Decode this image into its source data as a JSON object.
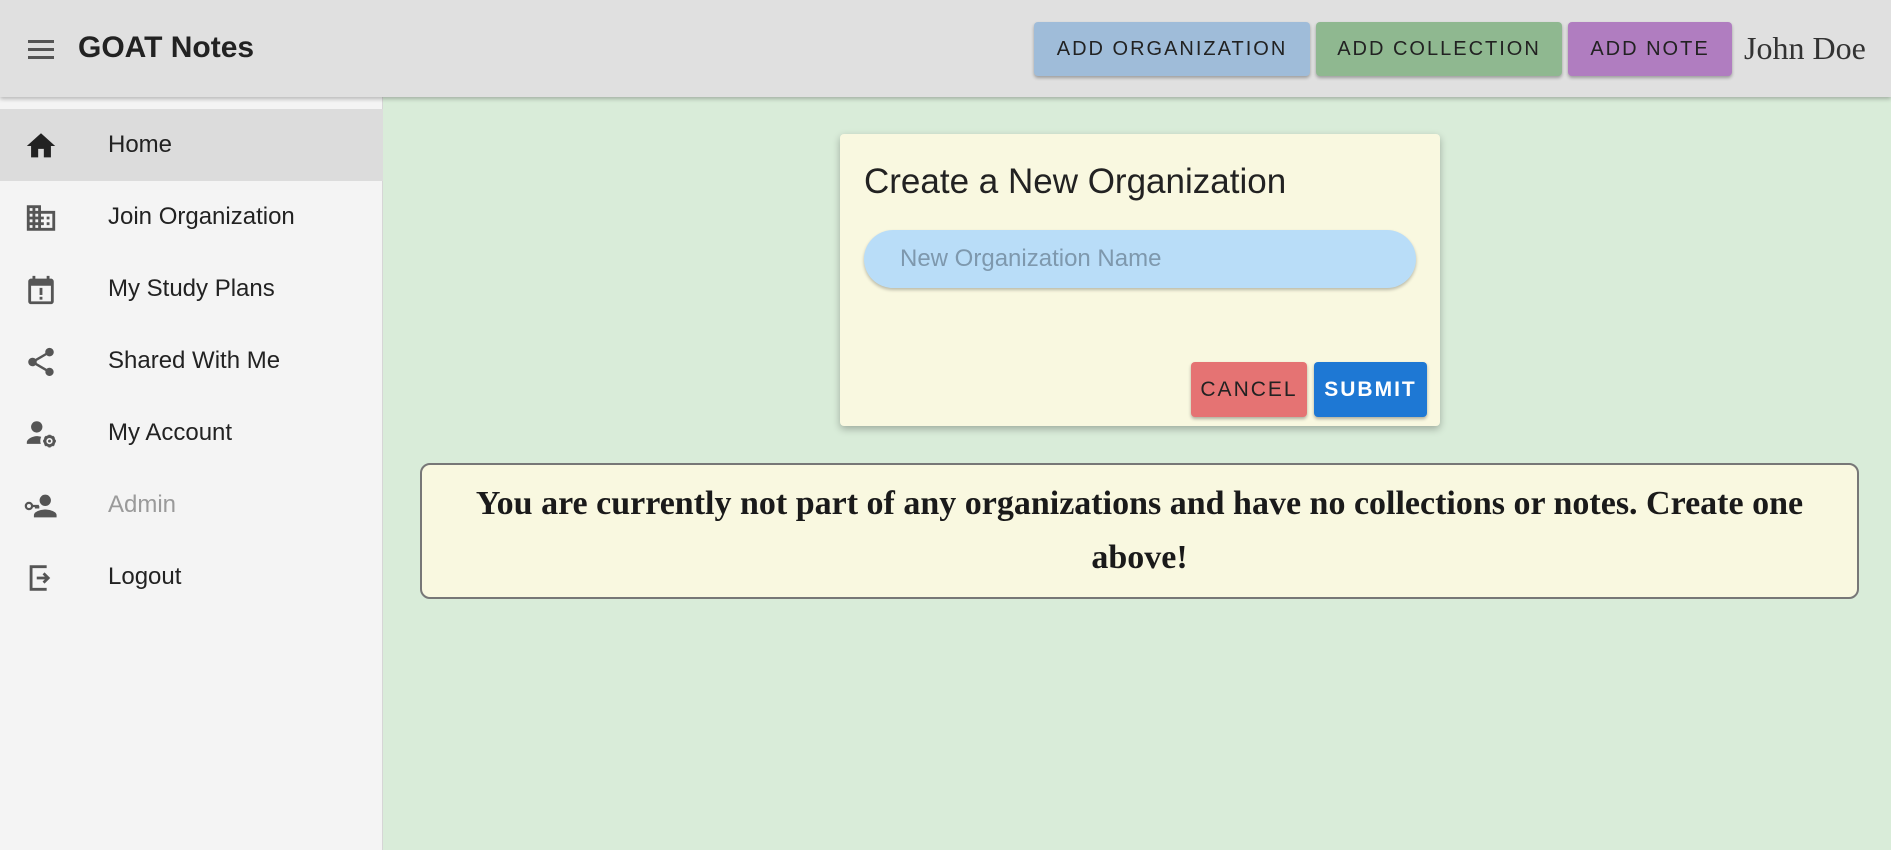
{
  "app": {
    "title": "GOAT Notes",
    "user_name": "John Doe"
  },
  "toolbar": {
    "add_organization_label": "ADD ORGANIZATION",
    "add_collection_label": "ADD COLLECTION",
    "add_note_label": "ADD NOTE"
  },
  "sidebar": {
    "items": [
      {
        "label": "Home",
        "icon": "home-icon",
        "active": true
      },
      {
        "label": "Join Organization",
        "icon": "building-icon"
      },
      {
        "label": "My Study Plans",
        "icon": "calendar-alert-icon"
      },
      {
        "label": "Shared With Me",
        "icon": "share-icon"
      },
      {
        "label": "My Account",
        "icon": "user-settings-icon"
      },
      {
        "label": "Admin",
        "icon": "user-key-icon",
        "disabled": true
      },
      {
        "label": "Logout",
        "icon": "logout-icon"
      }
    ]
  },
  "dialog": {
    "title": "Create a New Organization",
    "input_placeholder": "New Organization Name",
    "input_value": "",
    "cancel_label": "CANCEL",
    "submit_label": "SUBMIT"
  },
  "empty_state": {
    "message": "You are currently not part of any organizations and have no collections or notes. Create one above!"
  },
  "colors": {
    "content_bg": "#d9ecd9",
    "appbar_bg": "#e0e0e0",
    "add_organization_bg": "#9fbcd9",
    "add_collection_bg": "#8fb890",
    "add_note_bg": "#b07dc0",
    "card_bg": "#f9f8e0",
    "input_bg": "#b9ddf8",
    "cancel_bg": "#e57373",
    "submit_bg": "#1e78d4"
  }
}
